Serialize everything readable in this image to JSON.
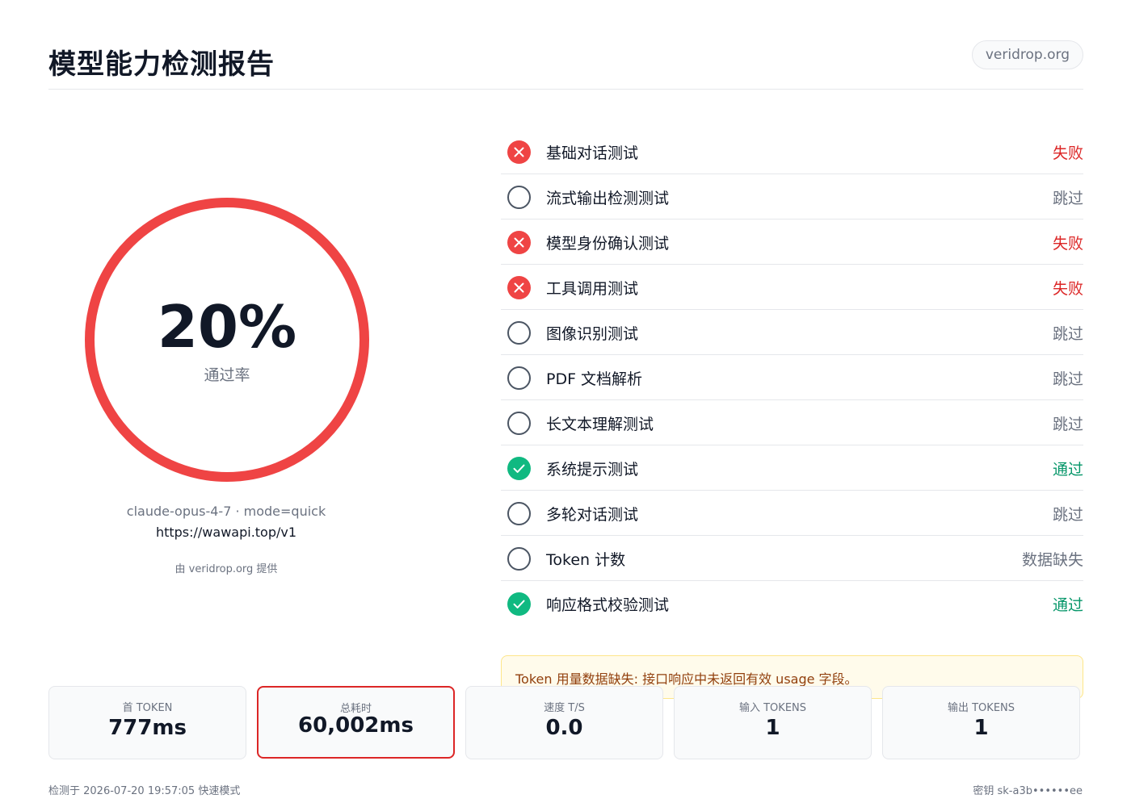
{
  "header": {
    "title": "模型能力检测报告",
    "domain_badge": "veridrop.org"
  },
  "summary": {
    "score": "20%",
    "score_value": 0.2,
    "score_label": "通过率",
    "score_color": "#ef4444",
    "model_line": "claude-opus-4-7  ·  mode=quick",
    "endpoint": "https://wawapi.top/v1",
    "powered_by": "由 veridrop.org 提供"
  },
  "checks": [
    {
      "name": "基础对话测试",
      "status": "失败",
      "state": "fail"
    },
    {
      "name": "流式输出检测测试",
      "status": "跳过",
      "state": "skip"
    },
    {
      "name": "模型身份确认测试",
      "status": "失败",
      "state": "fail"
    },
    {
      "name": "工具调用测试",
      "status": "失败",
      "state": "fail"
    },
    {
      "name": "图像识别测试",
      "status": "跳过",
      "state": "skip"
    },
    {
      "name": "PDF 文档解析",
      "status": "跳过",
      "state": "skip"
    },
    {
      "name": "长文本理解测试",
      "status": "跳过",
      "state": "skip"
    },
    {
      "name": "系统提示测试",
      "status": "通过",
      "state": "pass"
    },
    {
      "name": "多轮对话测试",
      "status": "跳过",
      "state": "skip"
    },
    {
      "name": "Token 计数",
      "status": "数据缺失",
      "state": "skip"
    },
    {
      "name": "响应格式校验测试",
      "status": "通过",
      "state": "pass"
    }
  ],
  "warning": {
    "text": "Token 用量数据缺失: 接口响应中未返回有效 usage 字段。"
  },
  "stats": [
    {
      "label": "首 TOKEN",
      "value": "777ms",
      "highlight": false
    },
    {
      "label": "总耗时",
      "value": "60,002ms",
      "highlight": true
    },
    {
      "label": "速度 T/S",
      "value": "0.0",
      "highlight": false
    },
    {
      "label": "输入 TOKENS",
      "value": "1",
      "highlight": false
    },
    {
      "label": "输出 TOKENS",
      "value": "1",
      "highlight": false
    }
  ],
  "footer": {
    "left": "检测于 2026-07-20 19:57:05 快速模式",
    "right": "密钥 sk-a3b••••••ee"
  },
  "colors": {
    "fail": "#ef4444",
    "pass": "#10b981",
    "skip": "#4b5563"
  }
}
